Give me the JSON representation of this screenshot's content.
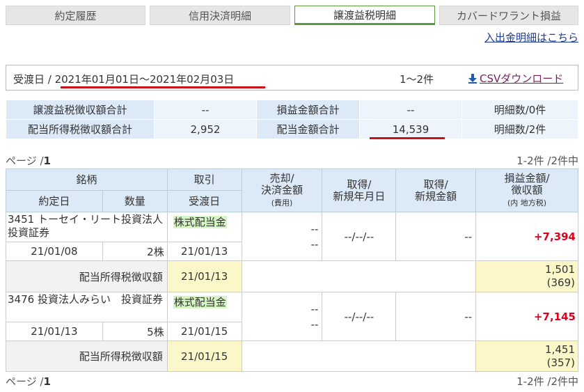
{
  "tabs": [
    "約定履歴",
    "信用決済明細",
    "譲渡益税明細",
    "カバードワラント損益"
  ],
  "deposit_link": "入出金明細はこちら",
  "filter": {
    "date_label": "受渡日 / ",
    "date_range": "2021年01月01日～2021年02月03日",
    "count": "1～2件",
    "csv": "CSVダウンロード"
  },
  "summary": {
    "r1": {
      "l1": "譲渡益税徴収額合計",
      "v1": "--",
      "l2": "損益金額合計",
      "v2": "--",
      "c": "明細数/0件"
    },
    "r2": {
      "l1": "配当所得税徴収額合計",
      "v1": "2,952",
      "l2": "配当金額合計",
      "v2": "14,539",
      "c": "明細数/2件"
    }
  },
  "pager": {
    "label": "ページ /",
    "page": "1",
    "count": "1-2件 /2件中"
  },
  "headers": {
    "meigara": "銘柄",
    "torihiki": "取引",
    "baikyaku1": "売却/",
    "baikyaku2": "決済金額",
    "baikyaku3": "(費用)",
    "shutoku_ymd1": "取得/",
    "shutoku_ymd2": "新規年月日",
    "shutoku_amt1": "取得/",
    "shutoku_amt2": "新規金額",
    "pl1": "損益金額/",
    "pl2": "徴収額",
    "pl3": "(内 地方税)",
    "yakujo": "約定日",
    "suryo": "数量",
    "ukewatashi": "受渡日"
  },
  "rows": [
    {
      "name": "3451 トーセイ・リート投資法人　投資証券",
      "type": "株式配当金",
      "sell1": "--",
      "sell2": "--",
      "acq_date": "--/--/--",
      "acq_amt": "--",
      "pl": "+7,394",
      "trade_date": "21/01/08",
      "qty": "2株",
      "settle": "21/01/13",
      "tax_label": "配当所得税徴収額",
      "tax_date": "21/01/13",
      "tax": "1,501",
      "tax_local": "(369)"
    },
    {
      "name": "3476 投資法人みらい　投資証券",
      "type": "株式配当金",
      "sell1": "--",
      "sell2": "--",
      "acq_date": "--/--/--",
      "acq_amt": "--",
      "pl": "+7,145",
      "trade_date": "21/01/13",
      "qty": "5株",
      "settle": "21/01/15",
      "tax_label": "配当所得税徴収額",
      "tax_date": "21/01/15",
      "tax": "1,451",
      "tax_local": "(357)"
    }
  ],
  "colors": {
    "accent_red": "#c8101b",
    "header_blue": "#dce9f7",
    "badge_green": "#d6f5c4",
    "highlight_yellow": "#fbf7c8"
  }
}
